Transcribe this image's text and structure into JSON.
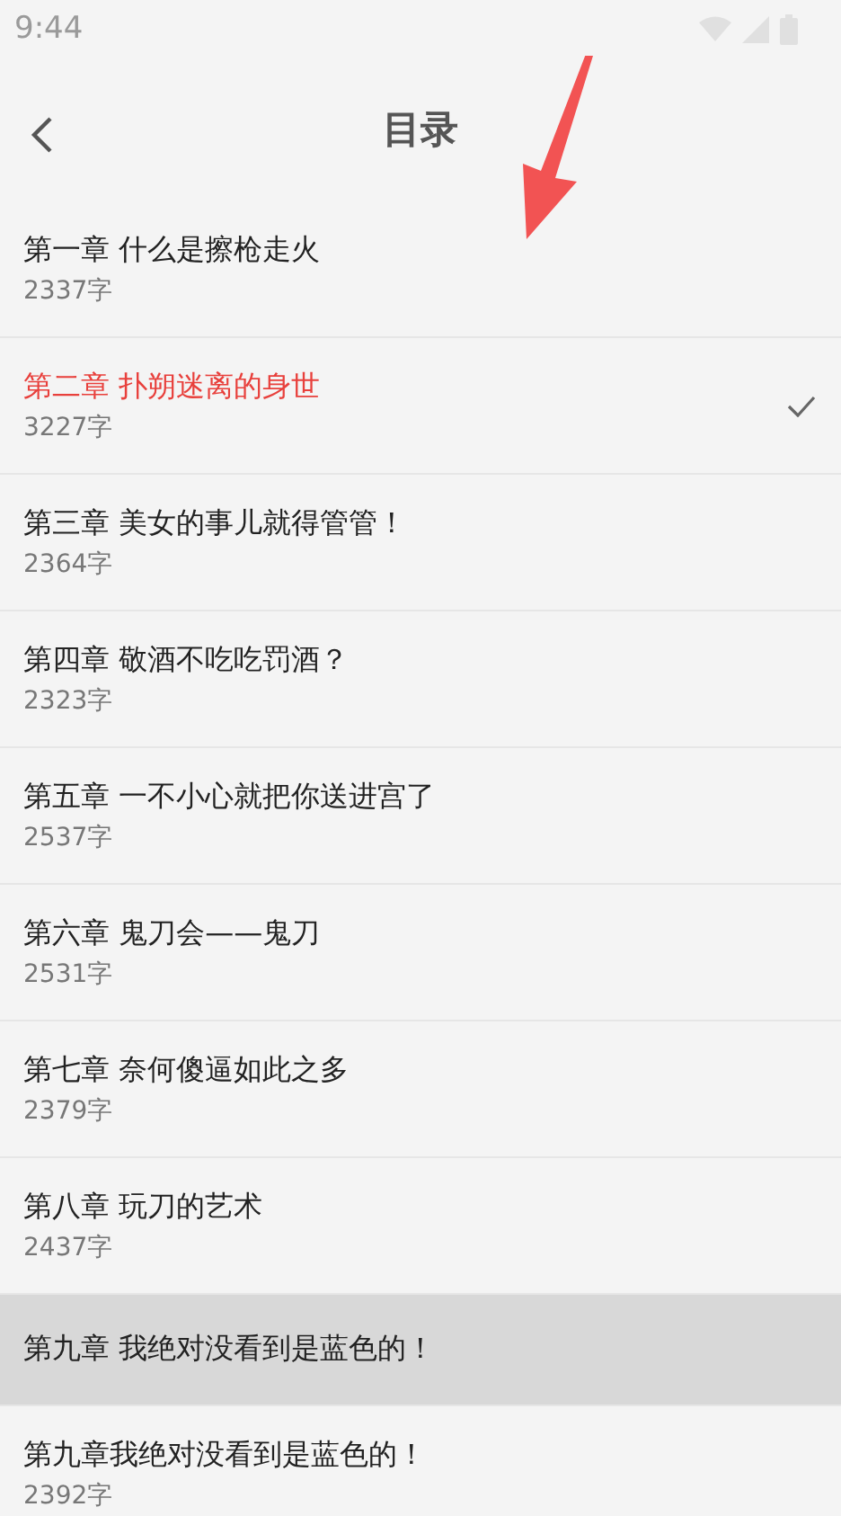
{
  "status_bar": {
    "time": "9:44"
  },
  "toolbar": {
    "title": "目录"
  },
  "chapters": [
    {
      "title": "第一章 什么是擦枪走火",
      "count": "2337字",
      "selected": false,
      "pressed": false
    },
    {
      "title": "第二章 扑朔迷离的身世",
      "count": "3227字",
      "selected": true,
      "pressed": false
    },
    {
      "title": "第三章 美女的事儿就得管管！",
      "count": "2364字",
      "selected": false,
      "pressed": false
    },
    {
      "title": "第四章 敬酒不吃吃罚酒？",
      "count": "2323字",
      "selected": false,
      "pressed": false
    },
    {
      "title": "第五章 一不小心就把你送进宫了",
      "count": "2537字",
      "selected": false,
      "pressed": false
    },
    {
      "title": "第六章 鬼刀会——鬼刀",
      "count": "2531字",
      "selected": false,
      "pressed": false
    },
    {
      "title": "第七章 奈何傻逼如此之多",
      "count": "2379字",
      "selected": false,
      "pressed": false
    },
    {
      "title": "第八章 玩刀的艺术",
      "count": "2437字",
      "selected": false,
      "pressed": false
    },
    {
      "title": "第九章 我绝对没看到是蓝色的！",
      "selected": false,
      "pressed": true
    },
    {
      "title": "第九章我绝对没看到是蓝色的！",
      "count": "2392字",
      "selected": false,
      "pressed": false
    }
  ]
}
